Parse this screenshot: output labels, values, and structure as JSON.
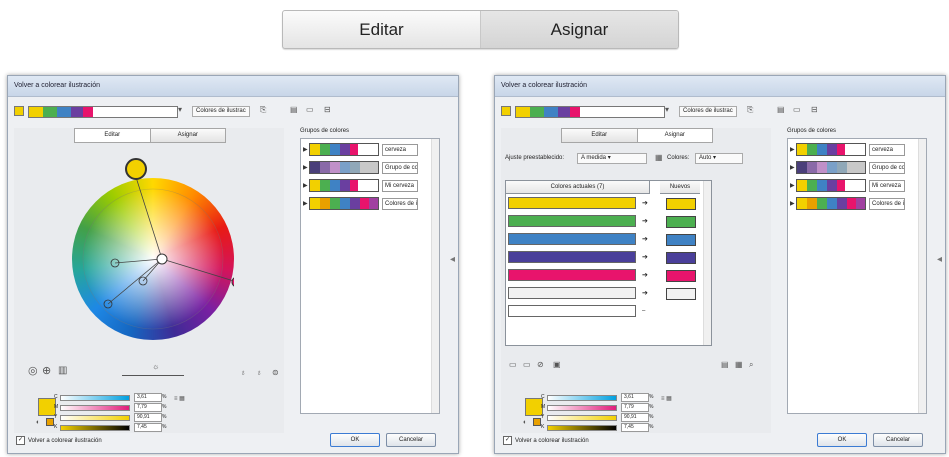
{
  "top_tabs": {
    "editar": "Editar",
    "asignar": "Asignar"
  },
  "dialog_title": "Volver a colorear ilustración",
  "colores_dropdown": "Colores de ilustrac",
  "inner_tabs": {
    "editar": "Editar",
    "asignar": "Asignar"
  },
  "groups_label": "Grupos de colores",
  "groups": [
    {
      "name": "cerveza",
      "colors": [
        "#f2d000",
        "#6a3fa0",
        "#3f82c4",
        "#4caf50",
        "#e8146c",
        "#ffffff",
        "#ffffff"
      ]
    },
    {
      "name": "Grupo de co...",
      "colors": [
        "#4a3f7a",
        "#8a6aa8",
        "#c090c8",
        "#7aa0c8",
        "#90a8b8",
        "#c8c8c8",
        "#b0b0b0"
      ]
    },
    {
      "name": "Mi cerveza",
      "colors": [
        "#f2d000",
        "#4caf50",
        "#3f82c4",
        "#6a3fa0",
        "#e8146c",
        "#ffffff",
        "#ffffff"
      ]
    },
    {
      "name": "Colores de il...",
      "colors": [
        "#f2d000",
        "#e8a000",
        "#4caf50",
        "#3f82c4",
        "#6a3fa0",
        "#e8146c",
        "#a040a0"
      ]
    }
  ],
  "sliders": [
    {
      "label": "C",
      "value": "3,61",
      "pct": "%"
    },
    {
      "label": "M",
      "value": "7,79",
      "pct": "%"
    },
    {
      "label": "Y",
      "value": "90,91",
      "pct": "%"
    },
    {
      "label": "K",
      "value": "7,45",
      "pct": "%"
    }
  ],
  "footer_check": "Volver a colorear ilustración",
  "ok": "OK",
  "cancel": "Cancelar",
  "assign": {
    "preset_label": "Ajuste preestablecido:",
    "preset_value": "A medida",
    "colores_label": "Colores:",
    "colores_value": "Auto",
    "col_current": "Colores actuales (7)",
    "col_new": "Nuevos",
    "rows": [
      "#f2d000",
      "#4caf50",
      "#3f82c4",
      "#4a3f9a",
      "#e8146c",
      "#f2f2f2",
      "#ffffff"
    ]
  },
  "main_swatch_color": "#f2d000"
}
